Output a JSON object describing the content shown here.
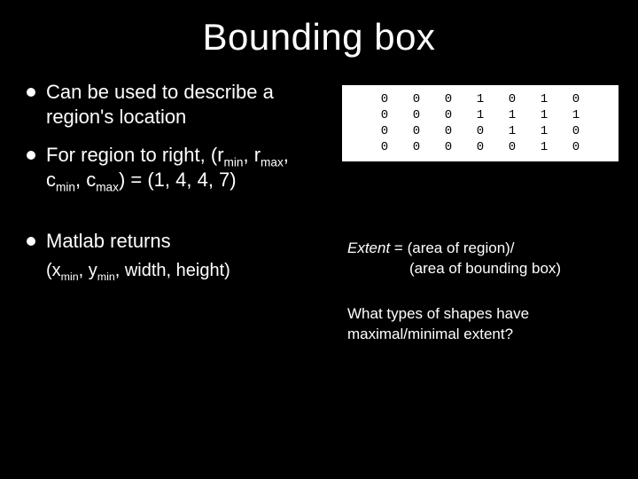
{
  "title": "Bounding box",
  "bullets": {
    "b1": "Can be used to describe a region's location",
    "b2_prefix": "For region to right, (r",
    "b2_min": "min",
    "b2_sep1": ", r",
    "b2_max": "max",
    "b2_sep2": ", c",
    "b2_sep3": ", c",
    "b2_suffix": ") = (1, 4, 4, 7)",
    "b3": "Matlab returns",
    "b3_paren_prefix": "(x",
    "b3_sep1": ", y",
    "b3_sep2": ", width, height)"
  },
  "matrix": [
    [
      "0",
      "0",
      "0",
      "1",
      "0",
      "1",
      "0"
    ],
    [
      "0",
      "0",
      "0",
      "1",
      "1",
      "1",
      "1"
    ],
    [
      "0",
      "0",
      "0",
      "0",
      "1",
      "1",
      "0"
    ],
    [
      "0",
      "0",
      "0",
      "0",
      "0",
      "1",
      "0"
    ]
  ],
  "extent": {
    "label": "Extent",
    "eq": " = (area of region)/",
    "line2": "(area of bounding box)"
  },
  "question": {
    "line1": "What types of shapes have",
    "line2": "maximal/minimal extent?"
  }
}
